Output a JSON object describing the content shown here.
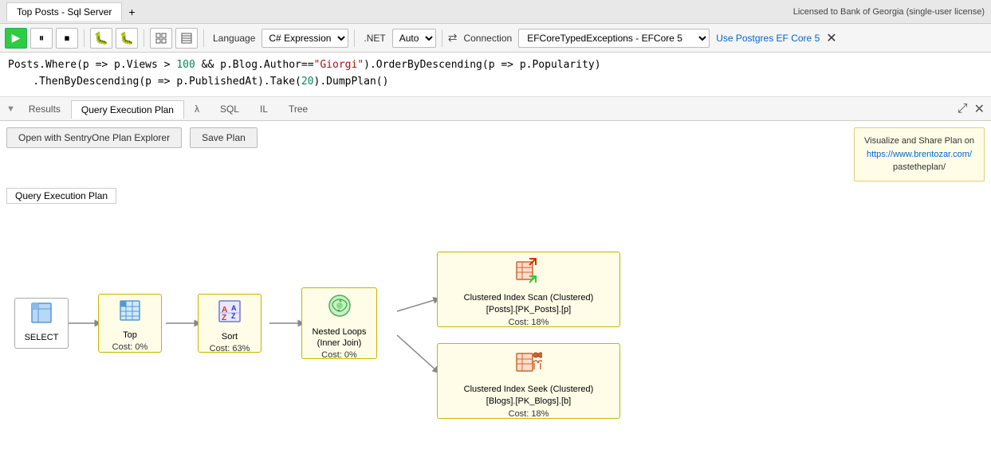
{
  "titleBar": {
    "tab": "Top Posts - Sql Server",
    "addTabLabel": "+",
    "license": "Licensed to Bank of Georgia (single-user license)"
  },
  "toolbar": {
    "playLabel": "▶",
    "pauseLabel": "⏸",
    "stopLabel": "⏹",
    "bugRedLabel": "🐛",
    "bugBlueLabel": "🐛",
    "gridIcon": "▦",
    "gridIcon2": "▦",
    "languageLabel": "Language",
    "languageValue": "C# Expression",
    "netLabel": ".NET",
    "netValue": "Auto",
    "connectionLabel": "Connection",
    "connectionValue": "EFCoreTypedExceptions - EFCore 5",
    "postgresLink": "Use Postgres EF Core 5",
    "closeLabel": "✕"
  },
  "code": {
    "line1": "Posts.Where(p => p.Views > 100 && p.Blog.Author==\"Giorgi\").OrderByDescending(p => p.Popularity)",
    "line2": "    .ThenByDescending(p => p.PublishedAt).Take(20).DumpPlan()"
  },
  "tabs": {
    "results": "Results",
    "queryPlan": "Query Execution Plan",
    "lambda": "λ",
    "sql": "SQL",
    "il": "IL",
    "tree": "Tree"
  },
  "buttons": {
    "openExplorer": "Open with SentryOne Plan Explorer",
    "savePlan": "Save Plan"
  },
  "infoBox": {
    "line1": "Visualize and Share Plan on",
    "line2": "https://www.brentozar.com/",
    "line3": "pastetheplan/"
  },
  "planTab": "Query Execution Plan",
  "nodes": {
    "select": {
      "label": "SELECT",
      "icon": "⊞"
    },
    "top": {
      "label": "Top",
      "cost": "Cost: 0%",
      "icon": "table"
    },
    "sort": {
      "label": "Sort",
      "cost": "Cost: 63%",
      "icon": "az"
    },
    "nestedLoops": {
      "label": "Nested Loops\n(Inner Join)",
      "cost": "Cost: 0%",
      "icon": "loop"
    },
    "clusteredScan": {
      "label": "Clustered Index Scan (Clustered)\n[Posts].[PK_Posts].[p]",
      "cost": "Cost: 18%",
      "icon": "scan"
    },
    "clusteredSeek": {
      "label": "Clustered Index Seek (Clustered)\n[Blogs].[PK_Blogs].[b]",
      "cost": "Cost: 18%",
      "icon": "seek"
    }
  }
}
